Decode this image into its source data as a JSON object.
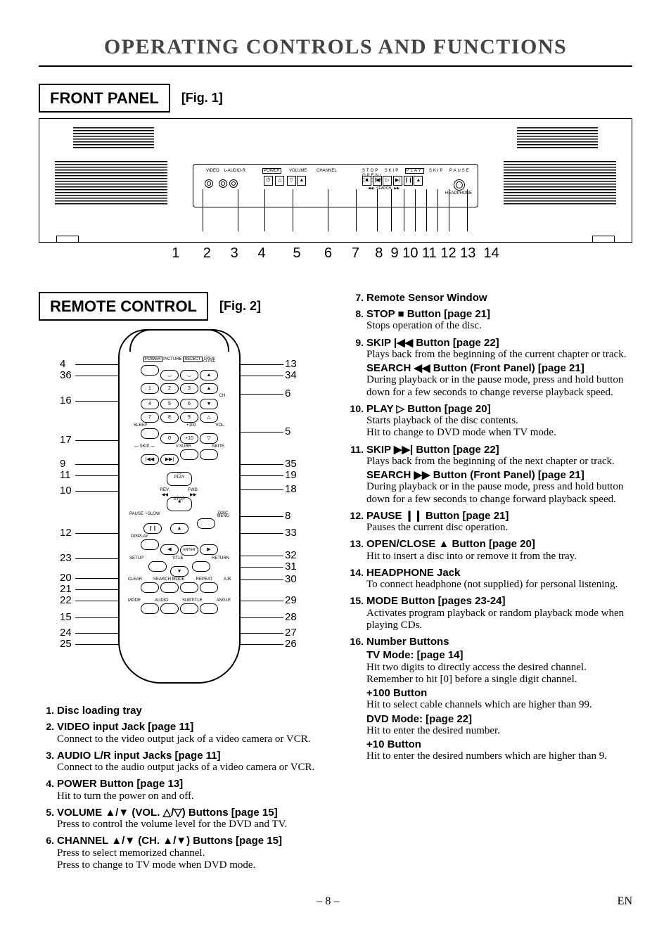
{
  "page_title": "OPERATING CONTROLS AND FUNCTIONS",
  "front_panel": {
    "heading": "FRONT PANEL",
    "fig": "[Fig. 1]",
    "labels": {
      "video": "VIDEO",
      "audio": "L-AUDIO-R",
      "power": "POWER",
      "volume": "VOLUME",
      "channel": "CHANNEL",
      "stop": "STOP",
      "skip1": "SKIP",
      "play": "PLAY",
      "skip2": "SKIP",
      "pause": "PAUSE",
      "open": "OPEN/\nCLOSE",
      "search": "SEARCH",
      "headphone": "HEADPHONE"
    },
    "numbers": "1      2     3     4       5      6     7    8  9 10 11 12 13  14"
  },
  "remote": {
    "heading": "REMOTE CONTROL",
    "fig": "[Fig. 2]",
    "btn": {
      "power": "POWER",
      "picture": "PICTURE",
      "select": "SELECT",
      "open": "OPEN/\nCLOSE",
      "n1": "1",
      "n2": "2",
      "n3": "3",
      "n4": "4",
      "n5": "5",
      "n6": "6",
      "n7": "7",
      "n8": "8",
      "n9": "9",
      "n0": "0",
      "ch": "CH.",
      "sleep": "SLEEP",
      "p100": "+100",
      "p10": "+10",
      "vol": "VOL.",
      "skip_l": "SKIP",
      "vsurr": "V.SURR",
      "mute": "MUTE",
      "play": "▷\nPLAY",
      "rev": "REV.\n◀◀",
      "fwd": "FWD.\n▶▶",
      "stop": "STOP\n■",
      "pause": "PAUSE",
      "slow": "SLOW",
      "disc": "DISC\nMENU",
      "display": "DISPLAY",
      "enter": "ENTER",
      "setup": "SETUP",
      "title": "TITLE",
      "return": "RETURN",
      "clear": "CLEAR",
      "search": "SEARCH MODE",
      "repeat": "REPEAT",
      "ab": "A-B",
      "mode": "MODE",
      "audio": "AUDIO",
      "subtitle": "SUBTITLE",
      "angle": "ANGLE"
    },
    "leads_left": [
      "4",
      "36",
      "16",
      "17",
      "9",
      "11",
      "10",
      "12",
      "23",
      "20",
      "21",
      "22",
      "15",
      "24",
      "25"
    ],
    "leads_right": [
      "13",
      "34",
      "6",
      "5",
      "35",
      "19",
      "18",
      "8",
      "33",
      "32",
      "31",
      "30",
      "29",
      "28",
      "27",
      "26"
    ]
  },
  "items_left": [
    {
      "n": "1.",
      "t": "Disc loading tray",
      "d": ""
    },
    {
      "n": "2.",
      "t": "VIDEO input Jack [page 11]",
      "d": "Connect to the video output jack of a video camera or VCR."
    },
    {
      "n": "3.",
      "t": "AUDIO L/R input Jacks [page 11]",
      "d": "Connect to the audio output jacks of a video camera or VCR."
    },
    {
      "n": "4.",
      "t": "POWER Button [page 13]",
      "d": "Hit to turn the power on and off."
    },
    {
      "n": "5.",
      "t": "VOLUME ▲/▼ (VOL. △/▽) Buttons [page 15]",
      "d": "Press to control the volume level for the DVD and TV."
    },
    {
      "n": "6.",
      "t": "CHANNEL ▲/▼ (CH. ▲/▼) Buttons [page 15]",
      "d": "Press to select memorized channel.\nPress to change to TV mode when DVD mode."
    }
  ],
  "items_right": [
    {
      "n": "7.",
      "t": "Remote Sensor Window",
      "d": ""
    },
    {
      "n": "8.",
      "t": "STOP ■ Button [page 21]",
      "d": "Stops operation of the disc."
    },
    {
      "n": "9.",
      "t": "SKIP |◀◀ Button [page 22]",
      "d": "Plays back from the beginning of the current chapter or track.",
      "sub": "SEARCH ◀◀ Button (Front Panel) [page 21]",
      "d2": "During playback or in the pause mode, press and hold button down for a few seconds to change reverse playback speed."
    },
    {
      "n": "10.",
      "t": "PLAY ▷ Button [page 20]",
      "d": "Starts playback of the disc contents.\nHit to change to DVD mode when TV mode."
    },
    {
      "n": "11.",
      "t": "SKIP ▶▶| Button [page 22]",
      "d": "Plays back from the beginning of the next chapter or track.",
      "sub": "SEARCH ▶▶ Button (Front Panel) [page 21]",
      "d2": "During playback or in the pause mode, press and hold button down for a few seconds to change forward playback speed."
    },
    {
      "n": "12.",
      "t": "PAUSE ❙❙ Button [page 21]",
      "d": "Pauses the current disc operation."
    },
    {
      "n": "13.",
      "t": "OPEN/CLOSE ▲ Button [page 20]",
      "d": "Hit to insert a disc into or remove it from the tray."
    },
    {
      "n": "14.",
      "t": "HEADPHONE Jack",
      "d": "To connect headphone (not supplied) for personal listening."
    },
    {
      "n": "15.",
      "t": "MODE Button [pages 23-24]",
      "d": "Activates program playback or random playback mode when playing CDs."
    },
    {
      "n": "16.",
      "t": "Number Buttons",
      "d": "",
      "extra": [
        {
          "sub": "TV Mode: [page 14]",
          "d": "Hit two digits to directly access the desired channel. Remember to hit [0] before a single digit channel."
        },
        {
          "sub": "+100 Button",
          "d": "Hit to select cable channels which are higher than 99."
        },
        {
          "sub": "DVD Mode: [page 22]",
          "d": "Hit to enter the desired number."
        },
        {
          "sub": "+10 Button",
          "d": "Hit to enter the desired numbers which are higher than 9."
        }
      ]
    }
  ],
  "footer": {
    "page": "– 8 –",
    "lang": "EN"
  }
}
